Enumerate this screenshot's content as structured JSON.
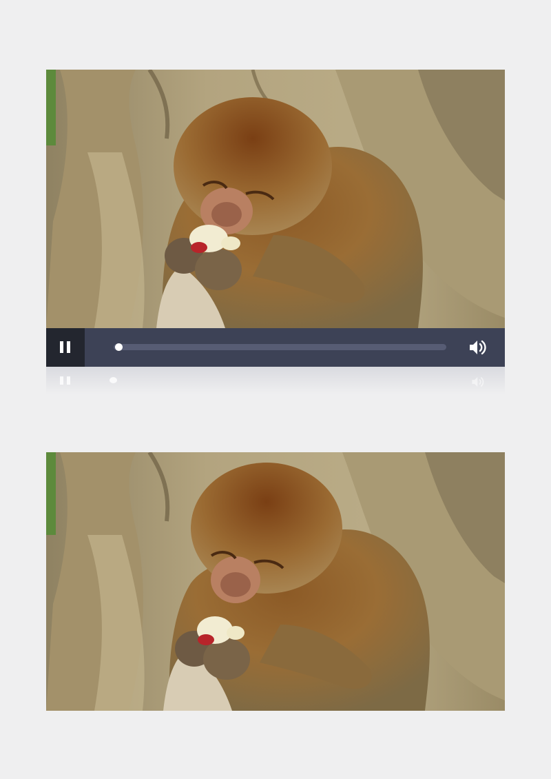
{
  "player": {
    "state": "playing",
    "progress": 0.0,
    "icons": {
      "pause": "pause-icon",
      "volume": "volume-icon"
    },
    "colors": {
      "control_bar": "#3d4256",
      "pause_button_bg": "#23262f",
      "track": "#575c74",
      "knob": "#ffffff"
    }
  },
  "video_frames": [
    {
      "subject": "monkey-eating-apple"
    },
    {
      "subject": "monkey-eating-apple"
    }
  ]
}
